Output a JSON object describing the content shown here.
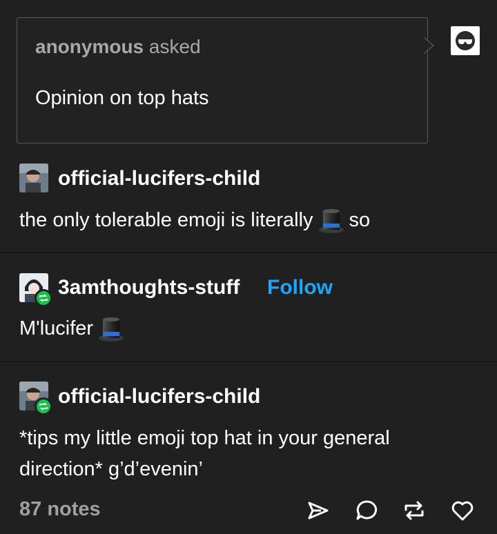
{
  "ask": {
    "asker": "anonymous",
    "verb": "asked",
    "question": "Opinion on top hats"
  },
  "posts": [
    {
      "username": "official-lucifers-child",
      "text_before": "the only tolerable emoji is literally",
      "text_after": "so",
      "reblogged": false
    },
    {
      "username": "3amthoughts-stuff",
      "follow_label": "Follow",
      "text_before": "M'lucifer",
      "reblogged": true
    },
    {
      "username": "official-lucifers-child",
      "text_line1": "*tips my little emoji top hat in your general",
      "text_line2": "direction* g’d’evenin’",
      "reblogged": true
    }
  ],
  "footer": {
    "notes": "87 notes"
  },
  "colors": {
    "background": "#202020",
    "accent_follow": "#1ea6ff",
    "reblog_green": "#19c14a",
    "muted_text": "#a0a0a0"
  },
  "icons": [
    "anonymous-avatar-icon",
    "top-hat-emoji",
    "reblog-icon",
    "share-icon",
    "reply-icon",
    "heart-icon"
  ]
}
